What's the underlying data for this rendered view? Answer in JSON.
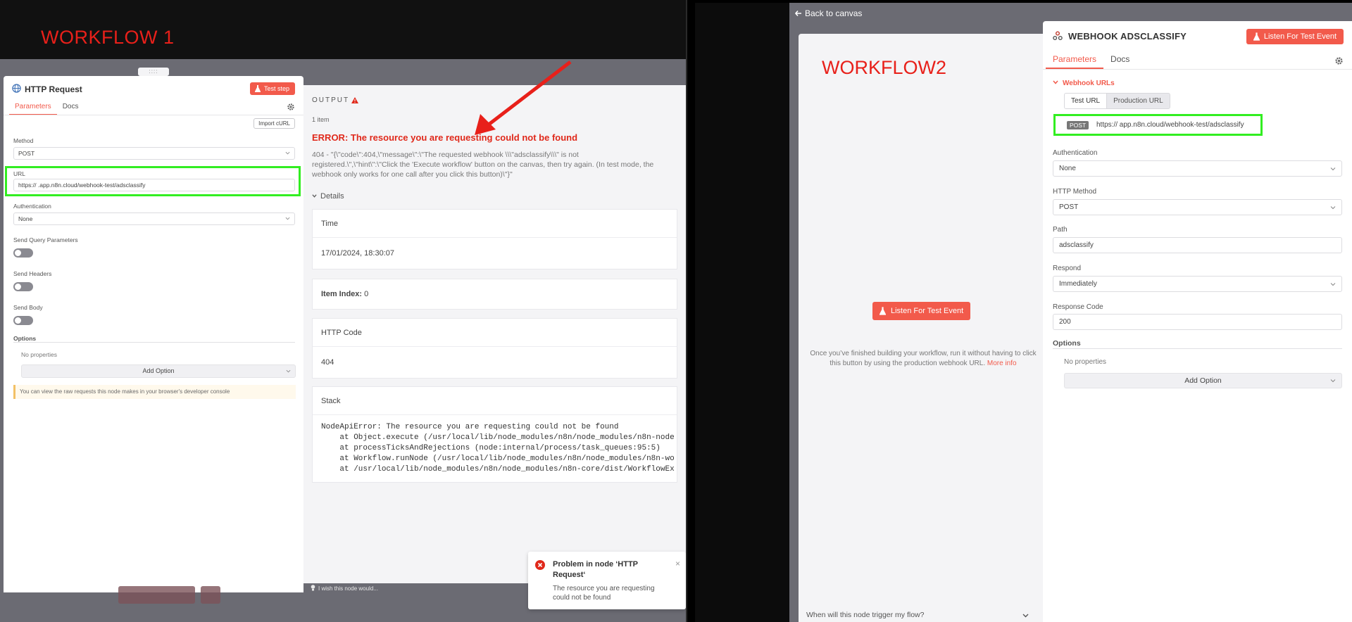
{
  "workflow1": {
    "label": "WORKFLOW 1",
    "handle": "::::",
    "node": {
      "title": "HTTP Request",
      "test_step": "Test step",
      "tabs": [
        "Parameters",
        "Docs"
      ],
      "import_curl": "Import cURL",
      "method_label": "Method",
      "method_value": "POST",
      "url_label": "URL",
      "url_value": "https://                    .app.n8n.cloud/webhook-test/adsclassify",
      "auth_label": "Authentication",
      "auth_value": "None",
      "send_query_label": "Send Query Parameters",
      "send_headers_label": "Send Headers",
      "send_body_label": "Send Body",
      "options_label": "Options",
      "no_properties": "No properties",
      "add_option": "Add Option",
      "hint": "You can view the raw requests this node makes in your browser's developer console"
    },
    "output": {
      "title": "OUTPUT",
      "item_count": "1 item",
      "error_title": "ERROR: The resource you are requesting could not be found",
      "error_desc": "404 - \"{\\\"code\\\":404,\\\"message\\\":\\\"The requested webhook \\\\\\\"adsclassify\\\\\\\" is not registered.\\\",\\\"hint\\\":\\\"Click the 'Execute workflow' button on the canvas, then try again. (In test mode, the webhook only works for one call after you click this button)\\\"}\"",
      "details_label": "Details",
      "time_label": "Time",
      "time_value": "17/01/2024, 18:30:07",
      "item_index_label": "Item Index:",
      "item_index_value": "0",
      "http_code_label": "HTTP Code",
      "http_code_value": "404",
      "stack_label": "Stack",
      "stack_lines": [
        "NodeApiError: The resource you are requesting could not be found",
        "    at Object.execute (/usr/local/lib/node_modules/n8n/node_modules/n8n-node",
        "    at processTicksAndRejections (node:internal/process/task_queues:95:5)",
        "    at Workflow.runNode (/usr/local/lib/node_modules/n8n/node_modules/n8n-wo",
        "    at /usr/local/lib/node_modules/n8n/node_modules/n8n-core/dist/WorkflowEx"
      ],
      "feedback": "I wish this node would..."
    },
    "toast": {
      "title": "Problem in node ‘HTTP Request‘",
      "message": "The resource you are requesting could not be found",
      "close": "×"
    }
  },
  "workflow2": {
    "back_to_canvas": "Back to canvas",
    "label": "WORKFLOW2",
    "listen_button": "Listen For Test Event",
    "trigger_hint": "Once you’ve finished building your workflow, run it without having to click this button by using the production webhook URL.",
    "more_info": "More info",
    "when_trigger": "When will this node trigger my flow?",
    "node": {
      "title": "WEBHOOK ADSCLASSIFY",
      "listen_button": "Listen For Test Event",
      "tabs": [
        "Parameters",
        "Docs"
      ],
      "webhook_urls": "Webhook URLs",
      "test_url": "Test URL",
      "production_url": "Production URL",
      "method_badge": "POST",
      "url": "https://                    app.n8n.cloud/webhook-test/adsclassify",
      "auth_label": "Authentication",
      "auth_value": "None",
      "http_method_label": "HTTP Method",
      "http_method_value": "POST",
      "path_label": "Path",
      "path_value": "adsclassify",
      "respond_label": "Respond",
      "respond_value": "Immediately",
      "response_code_label": "Response Code",
      "response_code_value": "200",
      "options_label": "Options",
      "no_properties": "No properties",
      "add_option": "Add Option"
    }
  },
  "colors": {
    "accent": "#f25a4b",
    "error": "#e0291b",
    "highlight": "#32ee21",
    "annotation": "#e8201a"
  }
}
